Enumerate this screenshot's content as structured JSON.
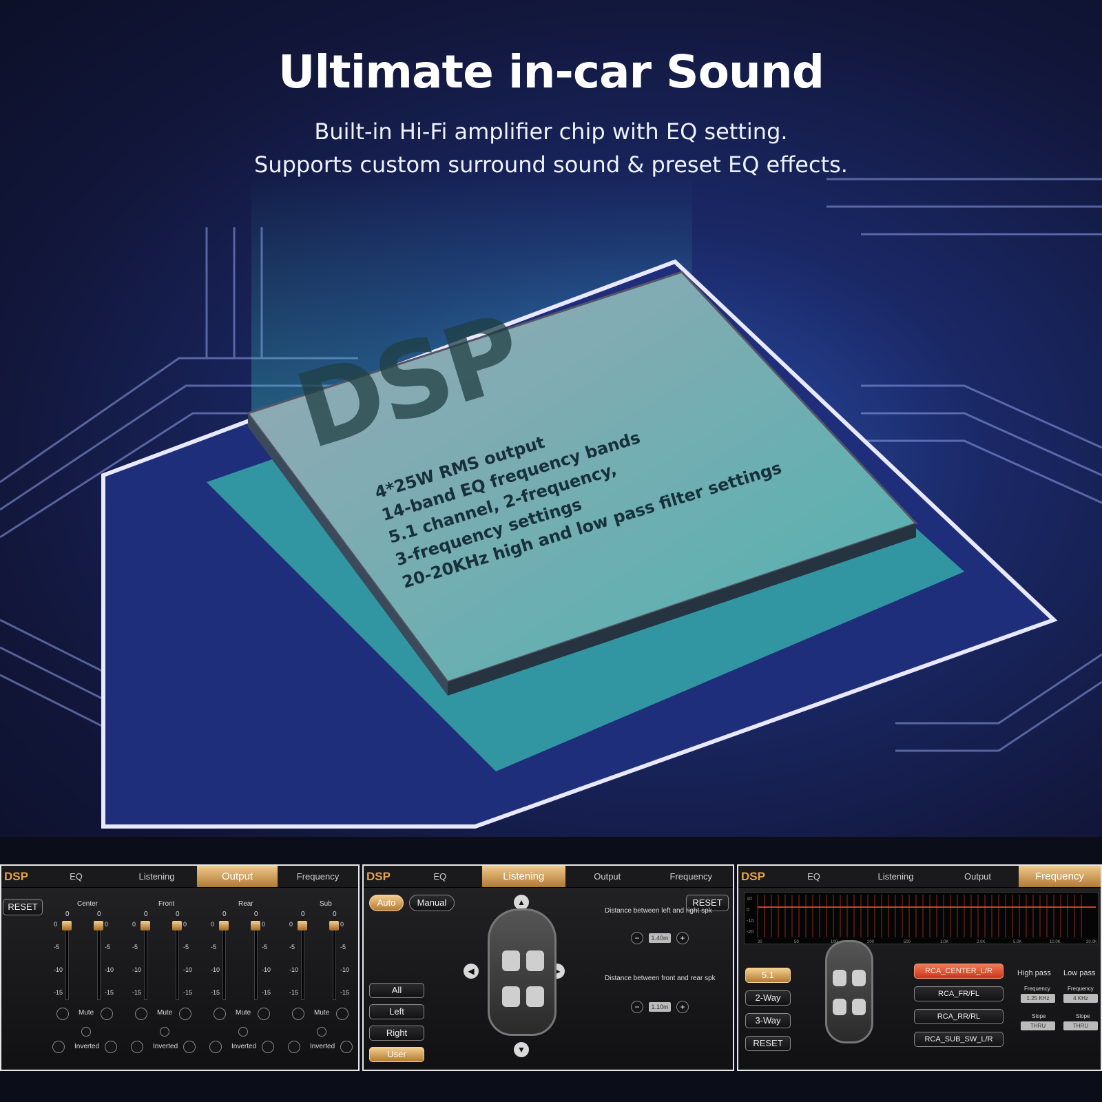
{
  "hero": {
    "title": "Ultimate in-car Sound",
    "subtitle_line1": "Built-in Hi-Fi amplifier chip with EQ setting.",
    "subtitle_line2": "Supports custom surround sound & preset EQ effects.",
    "chip_label": "DSP",
    "features": [
      "4*25W RMS output",
      "14-band EQ frequency bands",
      "5.1 channel, 2-frequency,",
      "3-frequency settings",
      "20-20KHz high and low pass filter settings"
    ]
  },
  "output_panel": {
    "logo": "DSP",
    "tabs": [
      "EQ",
      "Listening",
      "Output",
      "Frequency"
    ],
    "active_tab": "Output",
    "reset": "RESET",
    "channels": [
      "Center",
      "Front",
      "Rear",
      "Sub"
    ],
    "scale": [
      "0",
      "-5",
      "-10",
      "-15"
    ],
    "top_value": "0",
    "mute": "Mute",
    "inverted": "Inverted"
  },
  "listening_panel": {
    "logo": "DSP",
    "tabs": [
      "EQ",
      "Listening",
      "Output",
      "Frequency"
    ],
    "active_tab": "Listening",
    "auto": "Auto",
    "manual": "Manual",
    "reset": "RESET",
    "modes": [
      "All",
      "Left",
      "Right",
      "User"
    ],
    "active_mode": "User",
    "dist_lr_label": "Distance between left and right spk",
    "dist_lr_value": "1.40m",
    "dist_fr_label": "Distance between front and rear spk",
    "dist_fr_value": "1.10m",
    "minus": "−",
    "plus": "+"
  },
  "frequency_panel": {
    "logo": "DSP",
    "tabs": [
      "EQ",
      "Listening",
      "Output",
      "Frequency"
    ],
    "active_tab": "Frequency",
    "graph_y": [
      "10",
      "0",
      "-10",
      "-20"
    ],
    "graph_x": [
      "20",
      "50",
      "100",
      "200",
      "500",
      "1.0K",
      "2.0K",
      "5.0K",
      "10.0K",
      "20.0K"
    ],
    "modes": [
      "5.1",
      "2-Way",
      "3-Way",
      "RESET"
    ],
    "active_mode": "5.1",
    "channels": [
      "RCA_CENTER_L/R",
      "RCA_FR/FL",
      "RCA_RR/RL",
      "RCA_SUB_SW_L/R"
    ],
    "active_channel": "RCA_CENTER_L/R",
    "high_pass": "High pass",
    "low_pass": "Low pass",
    "frequency_label": "Frequency",
    "slope_label": "Slope",
    "hp_freq": "1.25 KHz",
    "lp_freq": "4 KHz",
    "hp_slope": "THRU",
    "lp_slope": "THRU"
  }
}
